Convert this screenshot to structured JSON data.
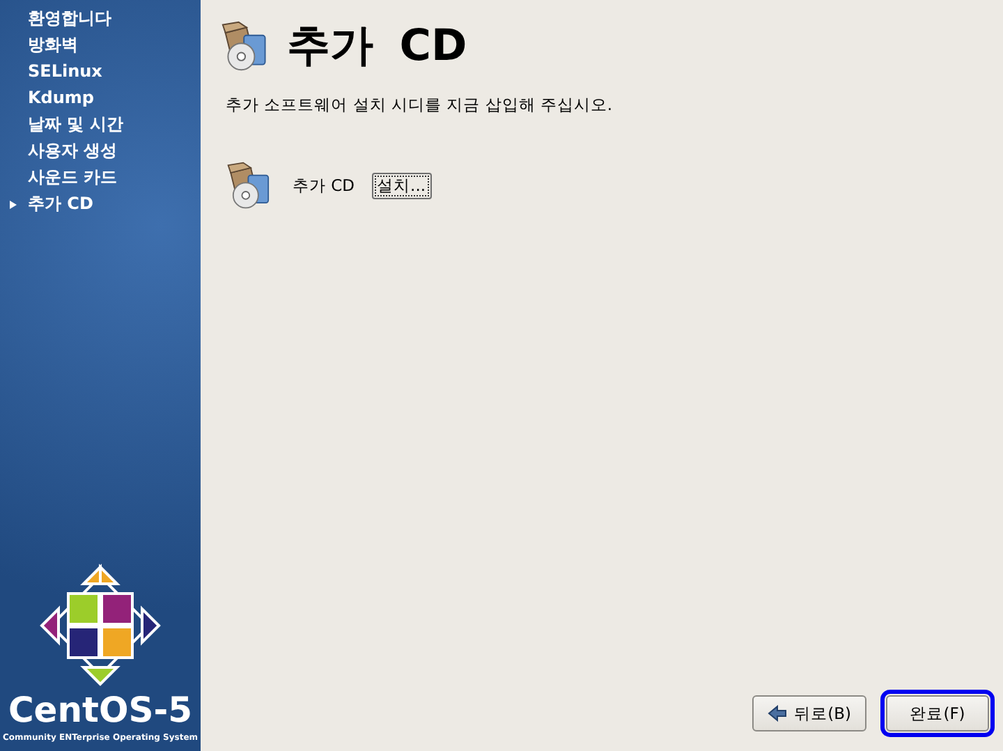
{
  "sidebar": {
    "items": [
      {
        "label": "환영합니다",
        "selected": false
      },
      {
        "label": "방화벽",
        "selected": false
      },
      {
        "label": "SELinux",
        "selected": false
      },
      {
        "label": "Kdump",
        "selected": false
      },
      {
        "label": "날짜 및 시간",
        "selected": false
      },
      {
        "label": "사용자 생성",
        "selected": false
      },
      {
        "label": "사운드 카드",
        "selected": false
      },
      {
        "label": "추가 CD",
        "selected": true
      }
    ],
    "logo": {
      "name": "CentOS-5",
      "tagline": "Community ENTerprise Operating System"
    }
  },
  "page": {
    "title": "추가 CD",
    "description": "추가 소프트웨어 설치 시디를 지금 삽입해 주십시오.",
    "entries": [
      {
        "label": "추가 CD",
        "button": "설치..."
      }
    ]
  },
  "buttons": [
    {
      "label": "뒤로(B)",
      "kind": "back",
      "focused": false
    },
    {
      "label": "완료(F)",
      "kind": "finish",
      "focused": true
    }
  ]
}
